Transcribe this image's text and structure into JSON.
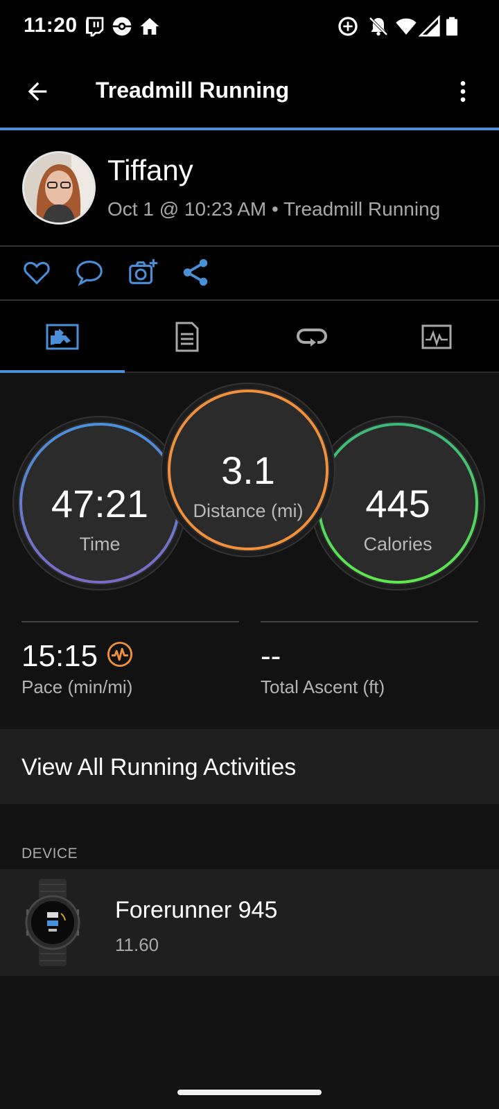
{
  "status_bar": {
    "time": "11:20",
    "left_icons": [
      "twitch-icon",
      "pokeball-icon",
      "home-icon"
    ],
    "right_icons": [
      "data-saver-icon",
      "bell-off-icon",
      "wifi-icon",
      "signal-icon",
      "battery-icon"
    ]
  },
  "app_bar": {
    "title": "Treadmill Running",
    "back_icon": "back-arrow-icon",
    "menu_icon": "more-vert-icon"
  },
  "header": {
    "user_name": "Tiffany",
    "subtitle": "Oct 1 @ 10:23 AM • Treadmill Running"
  },
  "actions": [
    "like-icon",
    "comment-icon",
    "add-photo-icon",
    "share-icon"
  ],
  "tabs": [
    "overview-tab",
    "stats-tab",
    "laps-tab",
    "charts-tab"
  ],
  "stats": {
    "time": {
      "value": "47:21",
      "label": "Time"
    },
    "distance": {
      "value": "3.1",
      "label": "Distance (mi)"
    },
    "calories": {
      "value": "445",
      "label": "Calories"
    }
  },
  "metrics": {
    "pace": {
      "value": "15:15",
      "label": "Pace (min/mi)"
    },
    "ascent": {
      "value": "--",
      "label": "Total Ascent (ft)"
    }
  },
  "view_all": "View All Running Activities",
  "device": {
    "section_label": "DEVICE",
    "name": "Forerunner 945",
    "version": "11.60"
  },
  "colors": {
    "accent_blue": "#4a90d9",
    "time_ring_top": "#4a90d9",
    "time_ring_bottom": "#7b6bc4",
    "distance_ring": "#f0903a",
    "calories_ring": "#4cd94c",
    "pace_icon": "#f0903a"
  }
}
